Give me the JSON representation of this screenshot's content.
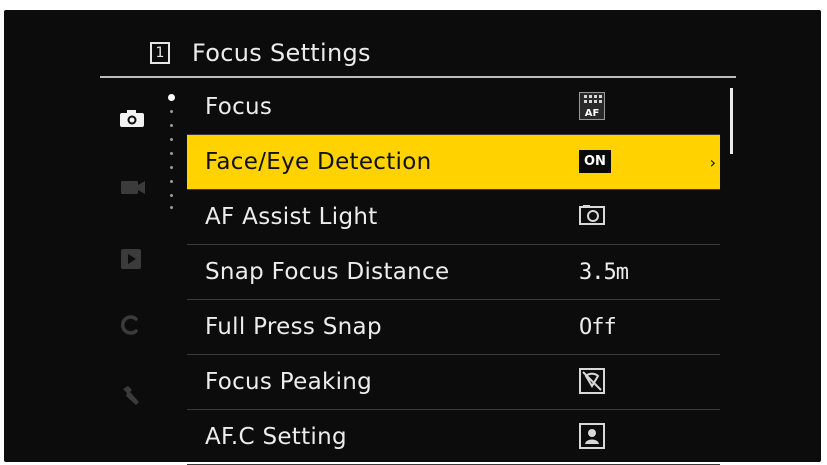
{
  "header": {
    "page_number": "1",
    "title": "Focus Settings"
  },
  "sidebar": {
    "tabs": [
      {
        "name": "camera",
        "icon": "camera-icon",
        "active": true
      },
      {
        "name": "video",
        "icon": "video-camera-icon",
        "active": false
      },
      {
        "name": "playback",
        "icon": "play-icon",
        "active": false
      },
      {
        "name": "custom",
        "icon": "custom-c-icon",
        "active": false
      },
      {
        "name": "setup",
        "icon": "wrench-icon",
        "active": false
      }
    ],
    "subpage_indicator": {
      "total": 9,
      "current": 1
    }
  },
  "menu": {
    "items": [
      {
        "label": "Focus",
        "value_type": "icon",
        "value_icon": "multi-af-icon"
      },
      {
        "label": "Face/Eye Detection",
        "value_type": "badge",
        "value": "ON",
        "selected": true
      },
      {
        "label": "AF Assist Light",
        "value_type": "icon",
        "value_icon": "af-assist-light-icon"
      },
      {
        "label": "Snap Focus Distance",
        "value_type": "text",
        "value": "3.5m"
      },
      {
        "label": "Full Press Snap",
        "value_type": "text",
        "value": "Off"
      },
      {
        "label": "Focus Peaking",
        "value_type": "icon",
        "value_icon": "peaking-off-icon"
      },
      {
        "label": "AF.C Setting",
        "value_type": "icon",
        "value_icon": "afc-setting-icon"
      }
    ]
  },
  "scrollbar": {
    "position_fraction": 0.0
  },
  "colors": {
    "background": "#0c0c0c",
    "highlight": "#ffd200",
    "text": "#ececec"
  }
}
